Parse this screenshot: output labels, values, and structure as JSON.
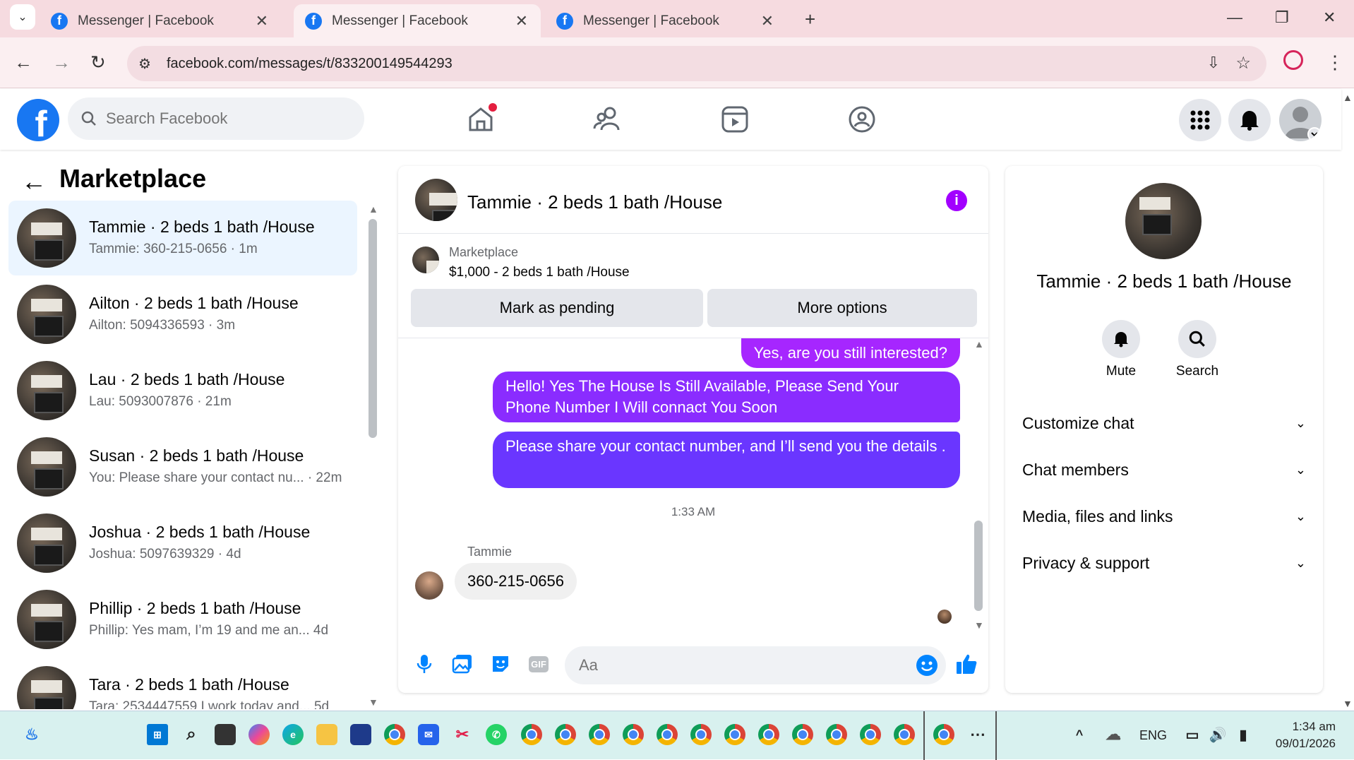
{
  "browser": {
    "tabs": [
      {
        "title": "Messenger | Facebook",
        "active": false
      },
      {
        "title": "Messenger | Facebook",
        "active": true
      },
      {
        "title": "Messenger | Facebook",
        "active": false
      }
    ],
    "url": "facebook.com/messages/t/833200149544293"
  },
  "fb": {
    "search_placeholder": "Search Facebook"
  },
  "left": {
    "title": "Marketplace",
    "conversations": [
      {
        "name": "Tammie · 2 beds 1 bath /House",
        "preview": "Tammie: 360-215-0656 · 1m",
        "selected": true
      },
      {
        "name": "Ailton · 2 beds 1 bath /House",
        "preview": "Ailton: 5094336593 · 3m"
      },
      {
        "name": "Lau · 2 beds 1 bath /House",
        "preview": "Lau: 5093007876 · 21m"
      },
      {
        "name": "Susan · 2 beds 1 bath /House",
        "preview": "You: Please share your contact nu... · 22m"
      },
      {
        "name": "Joshua · 2 beds 1 bath /House",
        "preview": "Joshua: 5097639329 · 4d"
      },
      {
        "name": "Phillip · 2 beds 1 bath /House",
        "preview": "Phillip: Yes mam, I’m 19 and me an...   4d"
      },
      {
        "name": "Tara · 2 beds 1 bath /House",
        "preview": "Tara: 2534447559 I work today and...   5d"
      }
    ]
  },
  "chat": {
    "title": "Tammie · 2 beds 1 bath /House",
    "marketplace_label": "Marketplace",
    "listing": "$1,000 - 2 beds 1 bath /House",
    "mark_pending": "Mark as pending",
    "more_options": "More options",
    "messages_out": [
      "Yes, are you still interested?",
      "Hello! Yes The House  Is Still Available, Please Send Your Phone Number I Will connact You Soon",
      "Please share your contact number, and I’ll send you the details ."
    ],
    "timestamp": "1:33 AM",
    "sender": "Tammie",
    "incoming": "360-215-0656",
    "input_placeholder": "Aa",
    "gif_label": "GIF"
  },
  "info": {
    "name": "Tammie · 2 beds 1 bath /House",
    "mute": "Mute",
    "search": "Search",
    "rows": [
      "Customize chat",
      "Chat members",
      "Media, files and links",
      "Privacy & support"
    ]
  },
  "taskbar": {
    "lang": "ENG",
    "time": "1:34 am",
    "date": "09/01/2026"
  },
  "colors": {
    "fb_blue": "#1877f2",
    "bubble_top": "#a200ff",
    "bubble_bottom": "#5b3dff"
  }
}
